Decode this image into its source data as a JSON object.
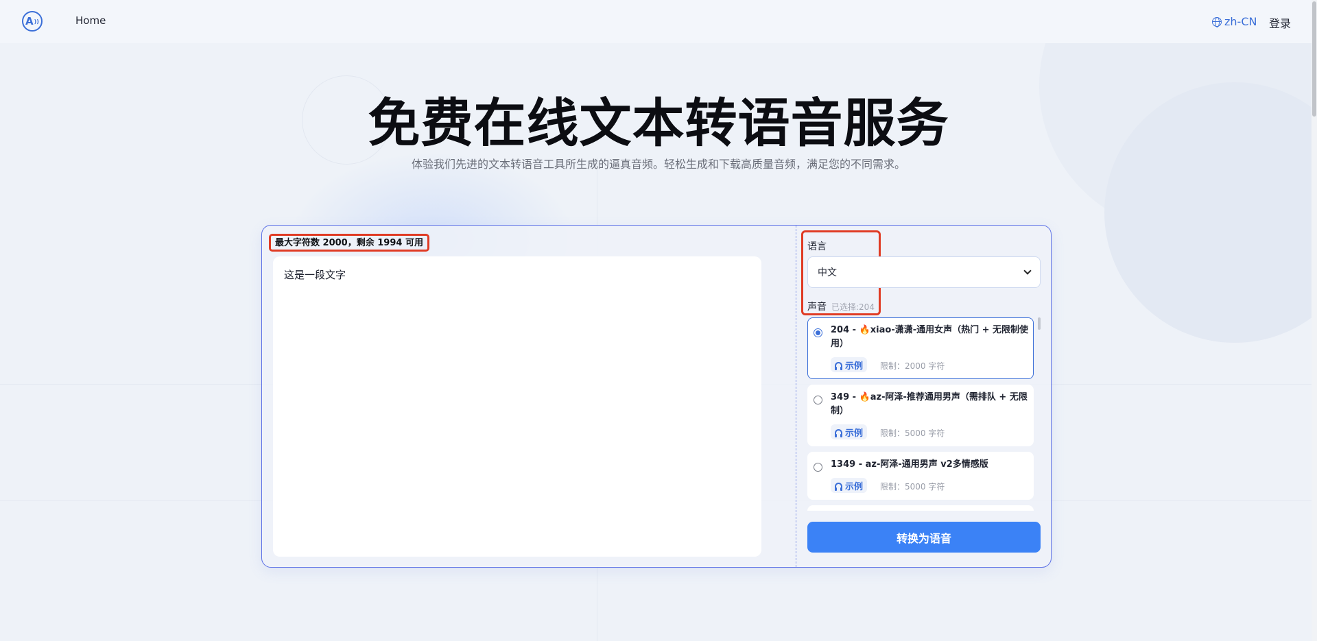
{
  "header": {
    "logo_text": "A",
    "nav_home": "Home",
    "language": "zh-CN",
    "login": "登录"
  },
  "hero": {
    "title": "免费在线文本转语音服务",
    "subtitle": "体验我们先进的文本转语音工具所生成的逼真音频。轻松生成和下载高质量音频，满足您的不同需求。"
  },
  "editor": {
    "char_counter": "最大字符数 2000，剩余 1994 可用",
    "text": "这是一段文字"
  },
  "settings": {
    "language_label": "语言",
    "language_value": "中文",
    "voice_label": "声音",
    "voice_selected": "已选择:204",
    "voices": [
      {
        "name": "204 - 🔥xiao-潇潇-通用女声（热门 + 无限制使用）",
        "example": "示例",
        "limit": "限制：2000 字符",
        "selected": true
      },
      {
        "name": "349 - 🔥az-阿泽-推荐通用男声（需排队 + 无限制）",
        "example": "示例",
        "limit": "限制：5000 字符",
        "selected": false
      },
      {
        "name": "1349 - az-阿泽-通用男声 v2多情感版",
        "example": "示例",
        "limit": "限制：5000 字符",
        "selected": false
      }
    ],
    "convert_button": "转换为语音"
  },
  "icons": {
    "logo": "logo-icon",
    "language": "globe-icon",
    "example": "headphone-icon",
    "dropdown": "chevron-down-icon"
  },
  "colors": {
    "accent": "#3b6fd8",
    "button": "#3b82f6",
    "highlight": "#e03b24",
    "card_border": "#5a6fe6"
  }
}
